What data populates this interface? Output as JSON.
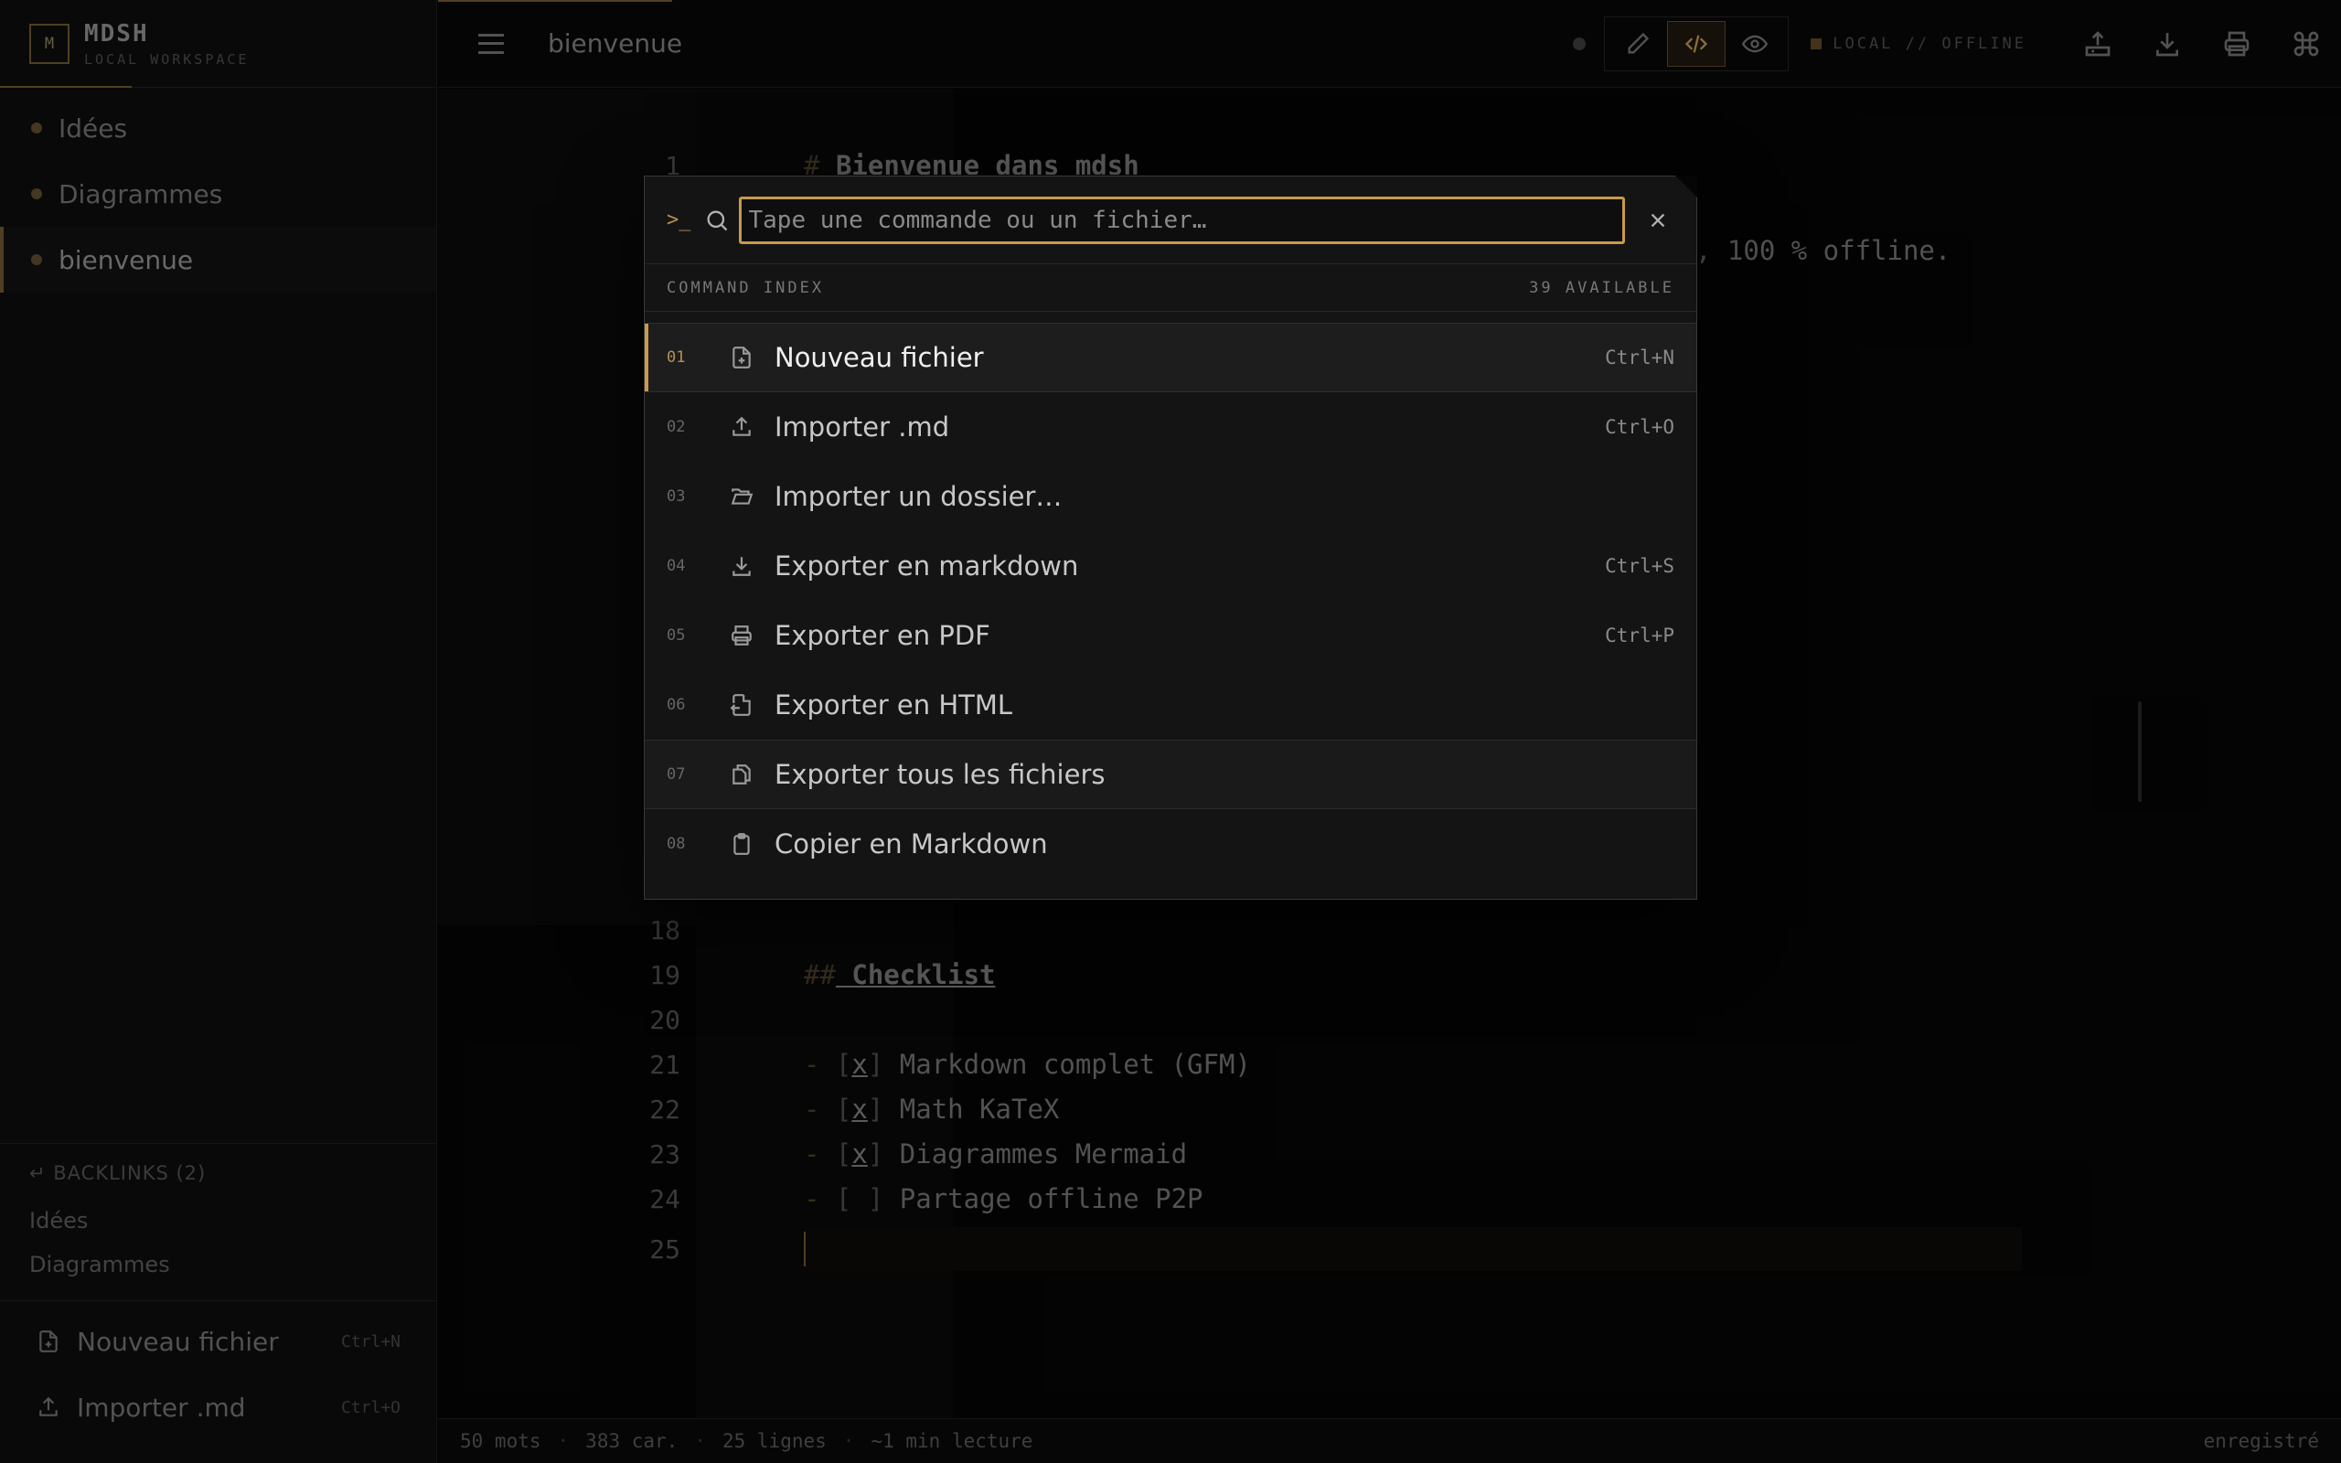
{
  "app": {
    "name": "MDSH",
    "subtitle": "LOCAL WORKSPACE",
    "logo_letter": "M"
  },
  "sidebar": {
    "items": [
      {
        "label": "Idées"
      },
      {
        "label": "Diagrammes"
      },
      {
        "label": "bienvenue",
        "active": true
      }
    ],
    "backlinks": {
      "header": "↵ BACKLINKS (2)",
      "items": [
        "Idées",
        "Diagrammes"
      ]
    },
    "actions": [
      {
        "label": "Nouveau fichier",
        "shortcut": "Ctrl+N",
        "icon": "file-plus-icon"
      },
      {
        "label": "Importer .md",
        "shortcut": "Ctrl+O",
        "icon": "upload-icon"
      }
    ]
  },
  "topbar": {
    "title": "bienvenue",
    "status_text": "LOCAL // OFFLINE",
    "modes": [
      "edit",
      "source",
      "preview"
    ],
    "active_mode": "source"
  },
  "editor": {
    "lines": [
      {
        "n": "1",
        "text": "# Bienvenue dans mdsh"
      },
      {
        "n": "18",
        "text": ""
      },
      {
        "n": "19",
        "text": "## Checklist"
      },
      {
        "n": "20",
        "text": ""
      },
      {
        "n": "21",
        "text": "- [x] Markdown complet (GFM)"
      },
      {
        "n": "22",
        "text": "- [x] Math KaTeX"
      },
      {
        "n": "23",
        "text": "- [x] Diagrammes Mermaid"
      },
      {
        "n": "24",
        "text": "- [ ] Partage offline P2P"
      },
      {
        "n": "25",
        "text": ""
      }
    ],
    "line1_hash": "#",
    "line1_heading": "Bienvenue dans mdsh",
    "line19_hash": "##",
    "line19_heading": " Checklist",
    "line2_trailing": ", 100 % offline.",
    "checklist": [
      {
        "checked": "x",
        "text": " Markdown complet (GFM)"
      },
      {
        "checked": "x",
        "text": " Math KaTeX"
      },
      {
        "checked": "x",
        "text": " Diagrammes Mermaid"
      },
      {
        "checked": " ",
        "text": " Partage offline P2P"
      }
    ]
  },
  "statusbar": {
    "words": "50 mots",
    "chars": "383 car.",
    "lines": "25 lignes",
    "reading": "~1 min lecture",
    "saved": "enregistré"
  },
  "palette": {
    "prompt": ">_",
    "search": {
      "placeholder": "Tape une commande ou un fichier…",
      "value": ""
    },
    "index_label": "COMMAND INDEX",
    "available": "39 AVAILABLE",
    "commands": [
      {
        "num": "01",
        "label": "Nouveau fichier",
        "shortcut": "Ctrl+N",
        "icon": "file-plus-icon"
      },
      {
        "num": "02",
        "label": "Importer .md",
        "shortcut": "Ctrl+O",
        "icon": "upload-icon"
      },
      {
        "num": "03",
        "label": "Importer un dossier…",
        "shortcut": "",
        "icon": "folder-open-icon"
      },
      {
        "num": "04",
        "label": "Exporter en markdown",
        "shortcut": "Ctrl+S",
        "icon": "download-icon"
      },
      {
        "num": "05",
        "label": "Exporter en PDF",
        "shortcut": "Ctrl+P",
        "icon": "printer-icon"
      },
      {
        "num": "06",
        "label": "Exporter en HTML",
        "shortcut": "",
        "icon": "file-export-icon"
      },
      {
        "num": "07",
        "label": "Exporter tous les fichiers",
        "shortcut": "",
        "icon": "files-icon"
      },
      {
        "num": "08",
        "label": "Copier en Markdown",
        "shortcut": "",
        "icon": "clipboard-icon"
      }
    ]
  },
  "colors": {
    "accent": "#c89a4c",
    "accent_dim": "#6b5530",
    "background": "#050505"
  }
}
